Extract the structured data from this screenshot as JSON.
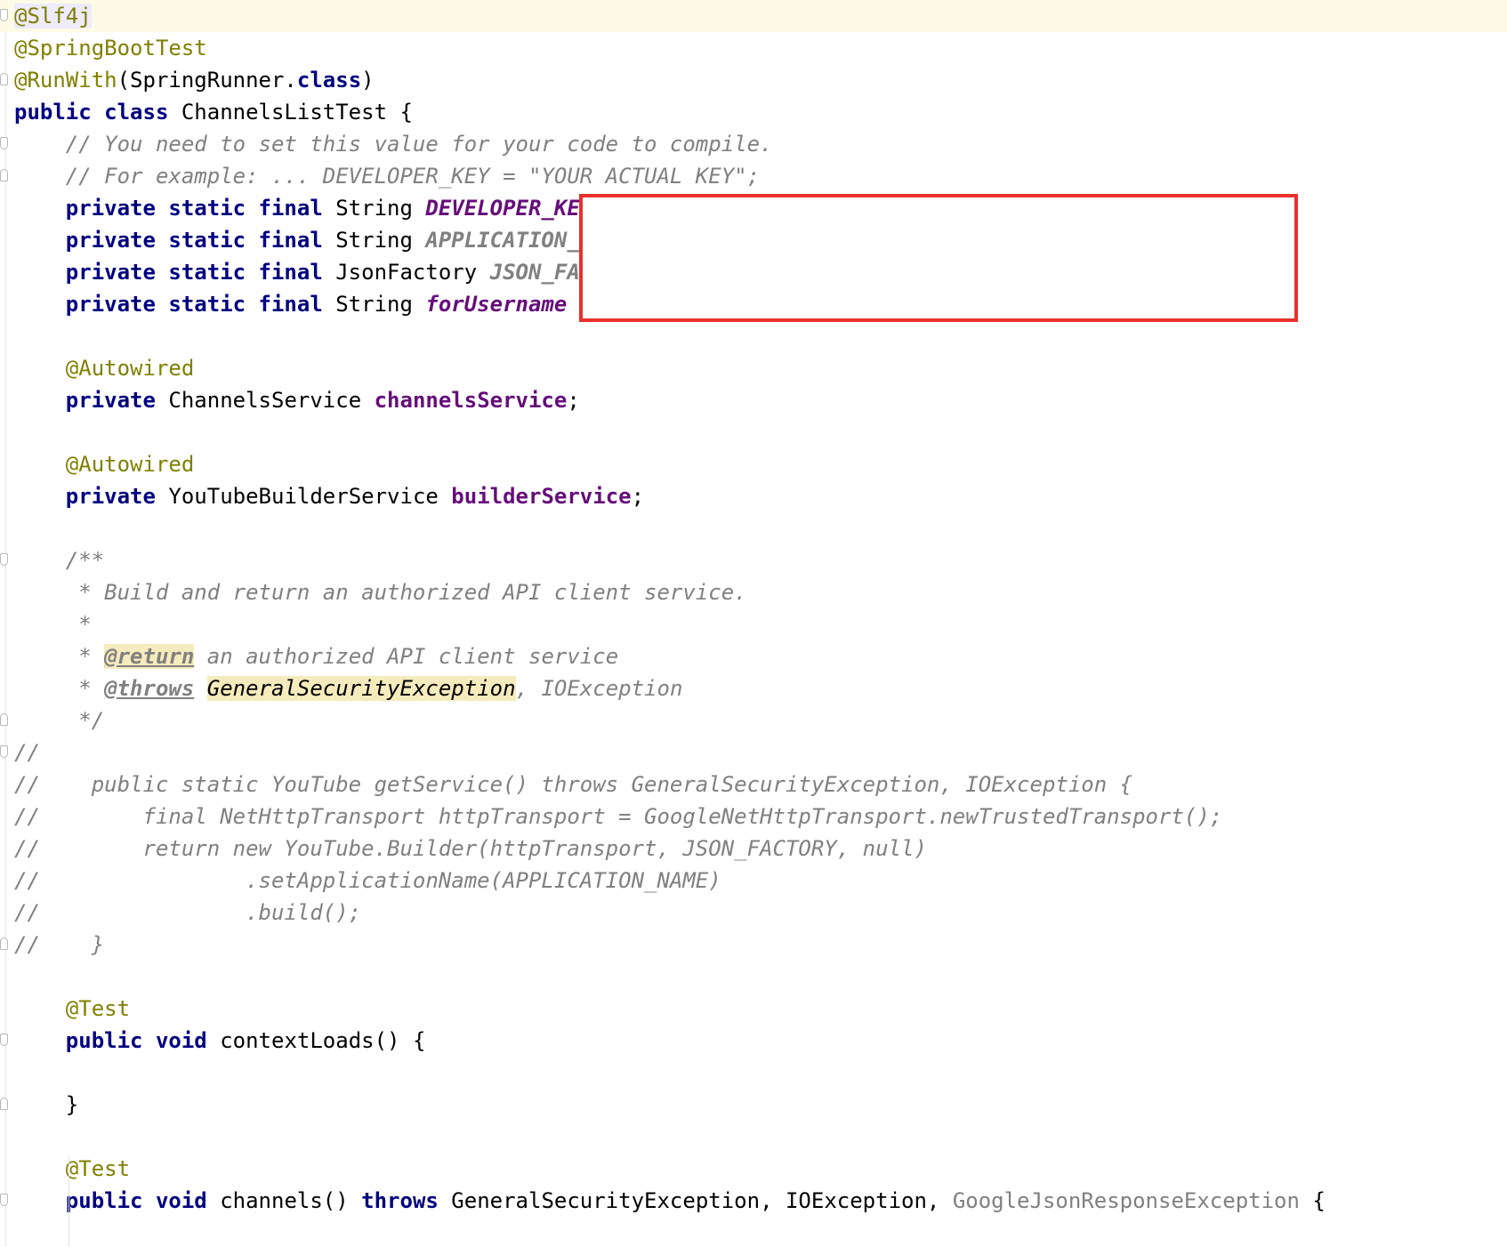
{
  "editor": {
    "language": "Java",
    "lines": [
      {
        "tokens": [
          {
            "t": "@Slf4j",
            "c": "ann sel-ann"
          }
        ]
      },
      {
        "tokens": [
          {
            "t": "@SpringBootTest",
            "c": "ann"
          }
        ]
      },
      {
        "tokens": [
          {
            "t": "@RunWith",
            "c": "ann"
          },
          {
            "t": "(SpringRunner.",
            "c": ""
          },
          {
            "t": "class",
            "c": "kw"
          },
          {
            "t": ")",
            "c": ""
          }
        ]
      },
      {
        "tokens": [
          {
            "t": "public class",
            "c": "kw"
          },
          {
            "t": " ChannelsListTest {",
            "c": ""
          }
        ]
      },
      {
        "tokens": [
          {
            "t": "    // You need to set this value for your code to compile.",
            "c": "cmt"
          }
        ]
      },
      {
        "tokens": [
          {
            "t": "    // For example: ... DEVELOPER_KEY = \"YOUR ACTUAL KEY\";",
            "c": "cmt"
          }
        ]
      },
      {
        "tokens": [
          {
            "t": "    ",
            "c": ""
          },
          {
            "t": "private static final",
            "c": "kw"
          },
          {
            "t": " String ",
            "c": ""
          },
          {
            "t": "DEVELOPER_KEY",
            "c": "const"
          }
        ]
      },
      {
        "tokens": [
          {
            "t": "    ",
            "c": ""
          },
          {
            "t": "private static final",
            "c": "kw"
          },
          {
            "t": " String ",
            "c": ""
          },
          {
            "t": "APPLICATION_N",
            "c": "constgray"
          }
        ]
      },
      {
        "tokens": [
          {
            "t": "    ",
            "c": ""
          },
          {
            "t": "private static final",
            "c": "kw"
          },
          {
            "t": " JsonFactory ",
            "c": ""
          },
          {
            "t": "JSON_FAC",
            "c": "constgray"
          }
        ]
      },
      {
        "tokens": [
          {
            "t": "    ",
            "c": ""
          },
          {
            "t": "private static final",
            "c": "kw"
          },
          {
            "t": " String ",
            "c": ""
          },
          {
            "t": "forUsername",
            "c": "const"
          },
          {
            "t": " =",
            "c": ""
          }
        ]
      },
      {
        "tokens": []
      },
      {
        "tokens": [
          {
            "t": "    @Autowired",
            "c": "ann"
          }
        ]
      },
      {
        "tokens": [
          {
            "t": "    ",
            "c": ""
          },
          {
            "t": "private",
            "c": "kw"
          },
          {
            "t": " ChannelsService ",
            "c": ""
          },
          {
            "t": "channelsService",
            "c": "field"
          },
          {
            "t": ";",
            "c": ""
          }
        ]
      },
      {
        "tokens": []
      },
      {
        "tokens": [
          {
            "t": "    @Autowired",
            "c": "ann"
          }
        ]
      },
      {
        "tokens": [
          {
            "t": "    ",
            "c": ""
          },
          {
            "t": "private",
            "c": "kw"
          },
          {
            "t": " YouTubeBuilderService ",
            "c": ""
          },
          {
            "t": "builderService",
            "c": "field"
          },
          {
            "t": ";",
            "c": ""
          }
        ]
      },
      {
        "tokens": []
      },
      {
        "tokens": [
          {
            "t": "    /**",
            "c": "cmt"
          }
        ]
      },
      {
        "tokens": [
          {
            "t": "     * Build and return an authorized API client service.",
            "c": "cmt"
          }
        ]
      },
      {
        "tokens": [
          {
            "t": "     *",
            "c": "cmt"
          }
        ]
      },
      {
        "tokens": [
          {
            "t": "     * ",
            "c": "cmt"
          },
          {
            "t": "@return",
            "c": "tag hl"
          },
          {
            "t": " an authorized API client service",
            "c": "cmt"
          }
        ]
      },
      {
        "tokens": [
          {
            "t": "     * ",
            "c": "cmt"
          },
          {
            "t": "@throws",
            "c": "tag"
          },
          {
            "t": " ",
            "c": "cmt"
          },
          {
            "t": "GeneralSecurityException",
            "c": "ref hl"
          },
          {
            "t": ", IOException",
            "c": "cmt"
          }
        ]
      },
      {
        "tokens": [
          {
            "t": "     */",
            "c": "cmt"
          }
        ]
      },
      {
        "tokens": [
          {
            "t": "//",
            "c": "lcmt"
          }
        ]
      },
      {
        "tokens": [
          {
            "t": "//    public static YouTube getService() throws GeneralSecurityException, IOException {",
            "c": "lcmt"
          }
        ]
      },
      {
        "tokens": [
          {
            "t": "//        final NetHttpTransport httpTransport = GoogleNetHttpTransport.newTrustedTransport();",
            "c": "lcmt"
          }
        ]
      },
      {
        "tokens": [
          {
            "t": "//        return new YouTube.Builder(httpTransport, JSON_FACTORY, null)",
            "c": "lcmt"
          }
        ]
      },
      {
        "tokens": [
          {
            "t": "//                .setApplicationName(APPLICATION_NAME)",
            "c": "lcmt"
          }
        ]
      },
      {
        "tokens": [
          {
            "t": "//                .build();",
            "c": "lcmt"
          }
        ]
      },
      {
        "tokens": [
          {
            "t": "//    }",
            "c": "lcmt"
          }
        ]
      },
      {
        "tokens": []
      },
      {
        "tokens": [
          {
            "t": "    @Test",
            "c": "ann"
          }
        ]
      },
      {
        "tokens": [
          {
            "t": "    ",
            "c": ""
          },
          {
            "t": "public void",
            "c": "kw"
          },
          {
            "t": " contextLoads() {",
            "c": ""
          }
        ]
      },
      {
        "tokens": []
      },
      {
        "tokens": [
          {
            "t": "    }",
            "c": ""
          }
        ]
      },
      {
        "tokens": []
      },
      {
        "tokens": [
          {
            "t": "    @Test",
            "c": "ann"
          }
        ]
      },
      {
        "tokens": [
          {
            "t": "    ",
            "c": ""
          },
          {
            "t": "public void",
            "c": "kw"
          },
          {
            "t": " channels() ",
            "c": ""
          },
          {
            "t": "throws",
            "c": "kw"
          },
          {
            "t": " GeneralSecurityException, IOException, ",
            "c": ""
          },
          {
            "t": "GoogleJsonResponseException",
            "c": "unused"
          },
          {
            "t": " {",
            "c": ""
          }
        ]
      }
    ],
    "fold_markers": [
      {
        "line": 0,
        "kind": "start"
      },
      {
        "line": 2,
        "kind": "end"
      },
      {
        "line": 4,
        "kind": "start"
      },
      {
        "line": 5,
        "kind": "end"
      },
      {
        "line": 17,
        "kind": "start"
      },
      {
        "line": 22,
        "kind": "end"
      },
      {
        "line": 23,
        "kind": "start"
      },
      {
        "line": 29,
        "kind": "end"
      },
      {
        "line": 32,
        "kind": "start"
      },
      {
        "line": 34,
        "kind": "end"
      },
      {
        "line": 37,
        "kind": "start"
      }
    ],
    "current_line": 0,
    "redaction": {
      "color": "#e8312d"
    }
  }
}
